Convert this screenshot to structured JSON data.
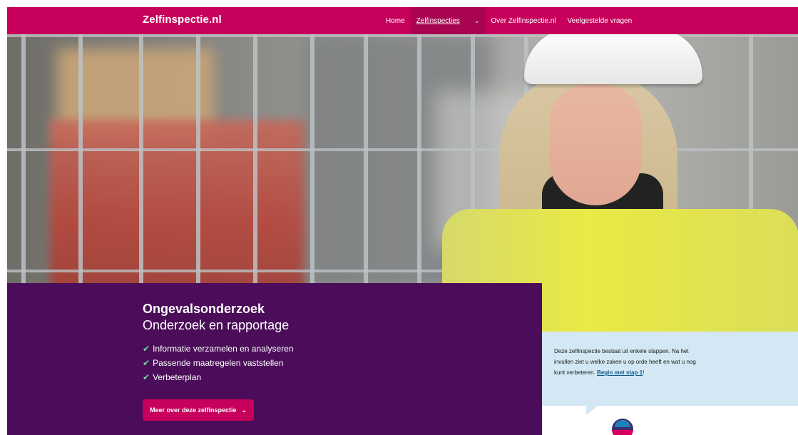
{
  "site": {
    "logo": "Zelfinspectie.nl"
  },
  "nav": {
    "items": [
      {
        "label": "Home"
      },
      {
        "label": "Zelfinspecties"
      },
      {
        "label": "Over Zelfinspectie.nl"
      },
      {
        "label": "Veelgestelde vragen"
      }
    ]
  },
  "hero": {
    "title": "Ongevalsonderzoek",
    "subtitle": "Onderzoek en rapportage",
    "checks": [
      "Informatie verzamelen en analyseren",
      "Passende maatregelen vaststellen",
      "Verbeterplan"
    ],
    "more_button": "Meer over deze zelfinspectie"
  },
  "info": {
    "text": "Deze zelfinspectie bestaat uit enkele stappen. Na het invullen ziet u welke zaken u op orde heeft en wat u nog kunt verbeteren.",
    "link": "Begin met stap 1",
    "suffix": "!"
  },
  "colors": {
    "brand": "#c7005b",
    "panel": "#4b0d59",
    "info_bg": "#d3e8f4",
    "check": "#6fd6a0"
  },
  "icons": {
    "nav_dropdown": "chevron-down-icon",
    "button_dropdown": "chevron-down-icon",
    "check": "check-icon"
  }
}
